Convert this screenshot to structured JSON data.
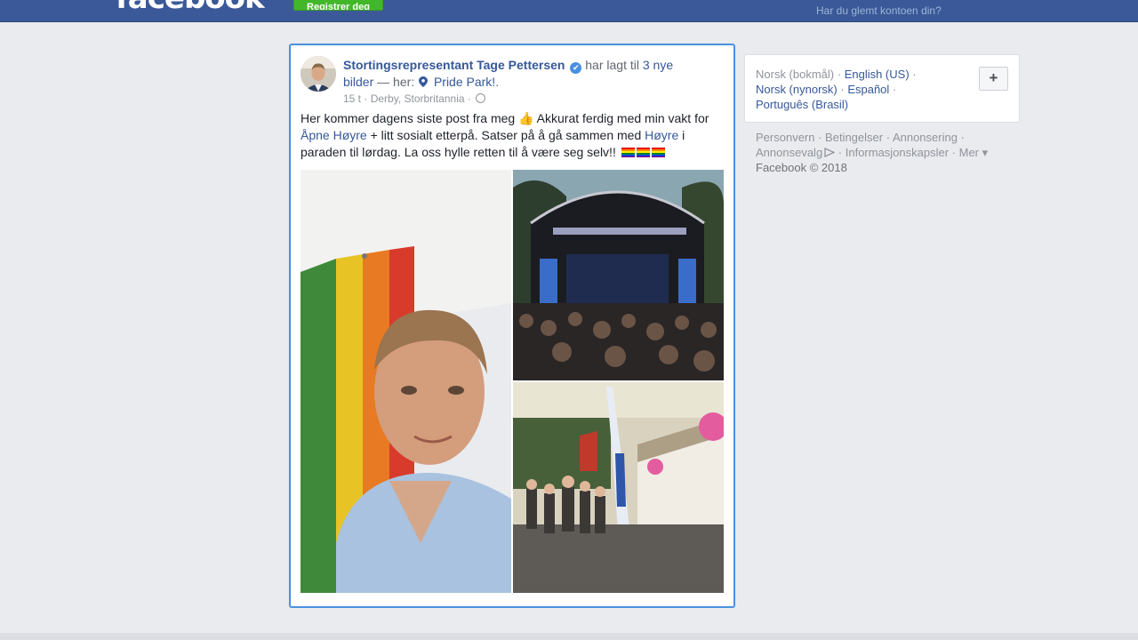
{
  "topbar": {
    "logo": "facebook",
    "signup_label": "Registrer deg",
    "forgot_link": "Har du glemt kontoen din?"
  },
  "post": {
    "author": "Stortingsrepresentant Tage Pettersen",
    "verified_icon": "check-icon",
    "action_pre": " har lagt til ",
    "photos_link": "3 nye bilder",
    "dash": " — her: ",
    "place": "Pride Park!",
    "place_suffix": ".",
    "time": "15 t",
    "location": "Derby, Storbritannia",
    "text_1": "Her kommer dagens siste post fra meg ",
    "emoji_thumb": "👍",
    "text_2": " Akkurat ferdig med min vakt for ",
    "link_1": "Åpne Høyre",
    "text_3": " + litt sosialt etterpå. Satser på å gå sammen med ",
    "link_2": "Høyre",
    "text_4": " i paraden til lørdag. La oss hylle retten til å være seg selv!! "
  },
  "sidebar": {
    "languages": {
      "current": "Norsk (bokmål)",
      "sep": " · ",
      "english": "English (US)",
      "nynorsk": "Norsk (nynorsk)",
      "espanol": "Español",
      "portugues": "Português (Brasil)"
    },
    "plus_label": "+",
    "footer": {
      "personvern": "Personvern",
      "betingelser": "Betingelser",
      "annonsering": "Annonsering",
      "annonsevalg": "Annonsevalg",
      "informasjon": "Informasjonskapsler",
      "mer": "Mer",
      "copyright": "Facebook © 2018"
    }
  },
  "colors": {
    "brand": "#3b5998",
    "link": "#365899",
    "focus_border": "#4a90e2",
    "signup": "#42b72a"
  }
}
